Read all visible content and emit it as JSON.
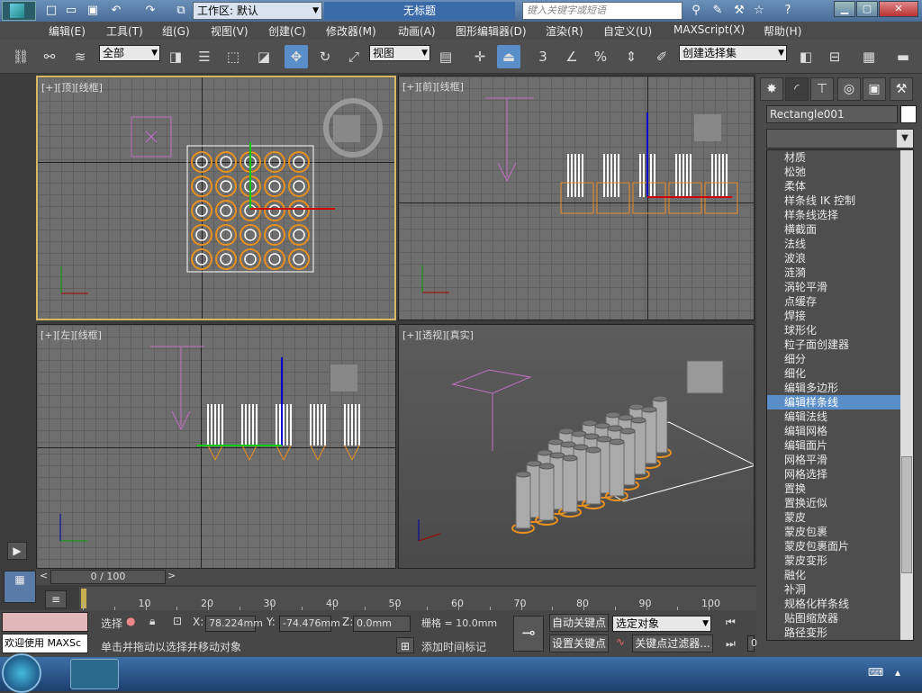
{
  "titlebar": {
    "workspace_label": "工作区: 默认",
    "doc_title": "无标题",
    "search_placeholder": "键入关键字或短语"
  },
  "menu": [
    "编辑(E)",
    "工具(T)",
    "组(G)",
    "视图(V)",
    "创建(C)",
    "修改器(M)",
    "动画(A)",
    "图形编辑器(D)",
    "渲染(R)",
    "自定义(U)",
    "MAXScript(X)",
    "帮助(H)"
  ],
  "toolbar": {
    "filter_select": "全部",
    "coord_select": "视图",
    "snap_label": "3",
    "percent_label": "%",
    "named_selection": "创建选择集"
  },
  "viewports": {
    "top": "[+][顶][线框]",
    "front": "[+][前][线框]",
    "left": "[+][左][线框]",
    "persp": "[+][透视][真实]"
  },
  "command_panel": {
    "object_name": "Rectangle001",
    "object_color": "#ffffff",
    "modifiers": [
      "材质",
      "松弛",
      "柔体",
      "样条线 IK 控制",
      "样条线选择",
      "横截面",
      "法线",
      "波浪",
      "涟漪",
      "涡轮平滑",
      "点缓存",
      "焊接",
      "球形化",
      "粒子面创建器",
      "细分",
      "细化",
      "编辑多边形",
      "编辑样条线",
      "编辑法线",
      "编辑网格",
      "编辑面片",
      "网格平滑",
      "网格选择",
      "置换",
      "置换近似",
      "蒙皮",
      "蒙皮包裹",
      "蒙皮包裹面片",
      "蒙皮变形",
      "融化",
      "补洞",
      "规格化样条线",
      "贴图缩放器",
      "路径变形"
    ],
    "highlighted_index": 17
  },
  "timeline": {
    "slider_label": "0 / 100",
    "ticks": [
      "10",
      "20",
      "30",
      "40",
      "50",
      "60",
      "70",
      "80",
      "90",
      "100"
    ]
  },
  "status": {
    "welcome": "欢迎使用 MAXSc",
    "select_label": "选择",
    "prompt": "单击并拖动以选择并移动对象",
    "x_label": "X:",
    "x_value": "78.224mm",
    "y_label": "Y:",
    "y_value": "-74.476mm",
    "z_label": "Z:",
    "z_value": "0.0mm",
    "grid": "栅格 = 10.0mm",
    "add_time_tag": "添加时间标记",
    "auto_key": "自动关键点",
    "set_key": "设置关键点",
    "key_mode": "选定对象",
    "key_filters": "关键点过滤器...",
    "frame": "0"
  },
  "accent": "#5a8ec8"
}
